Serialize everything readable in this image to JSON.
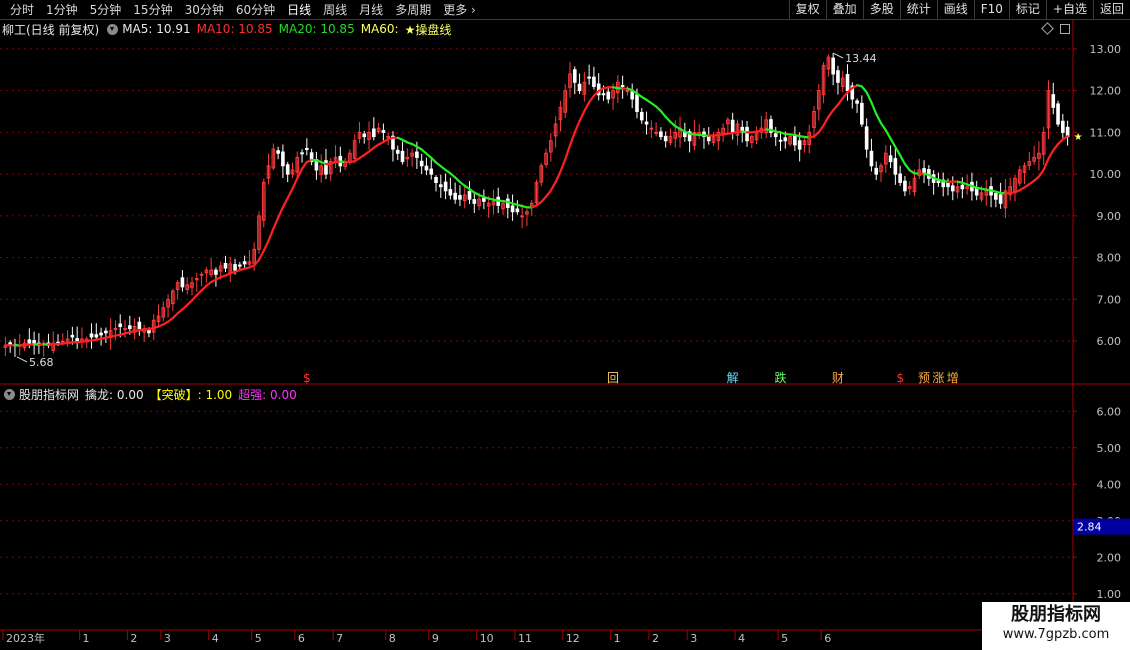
{
  "toolbar": {
    "tabs": [
      "分时",
      "1分钟",
      "5分钟",
      "15分钟",
      "30分钟",
      "60分钟",
      "日线",
      "周线",
      "月线",
      "多周期",
      "更多"
    ],
    "active_tab": "日线",
    "right_buttons": [
      "复权",
      "叠加",
      "多股",
      "统计",
      "画线",
      "F10",
      "标记",
      "+自选",
      "返回"
    ]
  },
  "main_legend": {
    "title": "柳工(日线 前复权)",
    "ma5": "MA5: 10.91",
    "ma10": "MA10: 10.85",
    "ma20": "MA20: 10.85",
    "ma60": "MA60:",
    "signal": "★操盘线"
  },
  "sub_legend": {
    "title": "股朋指标网",
    "qinlong": "擒龙: 0.00",
    "tupo": "【突破】: 1.00",
    "chaoqiang": "超强: 0.00"
  },
  "colors": {
    "up": "#ff3b3b",
    "down": "#ffffff",
    "ma_up": "#ff2020",
    "ma_down": "#22ee22",
    "grid": "#8b0000",
    "axis_text": "#c0c0c0",
    "ma10_color": "#ff3030",
    "ma20_color": "#22dd22",
    "ma60_color": "#ffff66",
    "signal_color": "#ffff66",
    "tupo_color": "#ffff00",
    "chaoqiang_color": "#ff33ff",
    "highlight_box": "#0000a0"
  },
  "watermark": {
    "name": "股朋指标网",
    "url": "www.7gpzb.com"
  },
  "chart_data": [
    {
      "type": "candlestick",
      "ylim": [
        5.5,
        13.5
      ],
      "y_ticks": [
        "13.00",
        "12.00",
        "11.00",
        "10.00",
        "9.00",
        "8.00",
        "7.00",
        "6.00"
      ],
      "y_tick_values": [
        13,
        12,
        11,
        10,
        9,
        8,
        7,
        6
      ],
      "x_labels": [
        "2023年",
        "1",
        "2",
        "3",
        "4",
        "5",
        "6",
        "7",
        "8",
        "9",
        "10",
        "11",
        "12",
        "1",
        "2",
        "3",
        "4",
        "5",
        "6"
      ],
      "x_label_index": [
        0,
        16,
        26,
        33,
        43,
        52,
        61,
        69,
        80,
        89,
        99,
        107,
        117,
        127,
        135,
        143,
        153,
        162,
        171
      ],
      "annotations": {
        "high": "13.44",
        "low": "5.68"
      },
      "closes": [
        5.9,
        5.9,
        5.9,
        5.9,
        5.95,
        5.95,
        5.95,
        5.9,
        5.95,
        5.9,
        5.95,
        5.95,
        6.0,
        6.05,
        6.1,
        6.0,
        6.05,
        6.05,
        6.1,
        6.1,
        6.15,
        6.2,
        6.25,
        6.3,
        6.35,
        6.3,
        6.3,
        6.35,
        6.3,
        6.3,
        6.2,
        6.5,
        6.6,
        6.8,
        7.0,
        7.2,
        7.4,
        7.3,
        7.35,
        7.4,
        7.5,
        7.6,
        7.7,
        7.7,
        7.6,
        7.8,
        7.75,
        7.85,
        7.7,
        7.8,
        7.85,
        7.9,
        8.2,
        9.0,
        9.8,
        10.2,
        10.6,
        10.5,
        10.2,
        10.0,
        10.1,
        10.4,
        10.5,
        10.6,
        10.3,
        10.1,
        10.2,
        10.0,
        10.3,
        10.4,
        10.2,
        10.3,
        10.5,
        10.8,
        11.0,
        10.9,
        11.0,
        10.9,
        11.1,
        11.0,
        10.9,
        10.6,
        10.5,
        10.3,
        10.4,
        10.5,
        10.4,
        10.2,
        10.1,
        10.0,
        9.8,
        9.7,
        9.6,
        9.5,
        9.4,
        9.4,
        9.5,
        9.4,
        9.3,
        9.4,
        9.35,
        9.3,
        9.35,
        9.25,
        9.3,
        9.2,
        9.1,
        9.1,
        9.0,
        9.1,
        9.3,
        9.8,
        10.2,
        10.5,
        10.8,
        11.2,
        11.6,
        12.0,
        12.4,
        12.2,
        12.0,
        12.2,
        12.3,
        12.1,
        11.9,
        11.9,
        11.8,
        12.0,
        12.2,
        12.1,
        12.0,
        11.8,
        11.5,
        11.3,
        11.2,
        11.1,
        11.0,
        10.9,
        10.8,
        10.9,
        11.0,
        11.1,
        10.9,
        10.8,
        11.0,
        11.0,
        10.9,
        10.8,
        10.9,
        11.0,
        11.1,
        11.3,
        11.0,
        11.2,
        11.0,
        10.8,
        10.9,
        11.0,
        11.1,
        11.3,
        11.0,
        10.9,
        10.8,
        10.8,
        10.9,
        10.7,
        10.6,
        10.8,
        11.0,
        11.5,
        12.0,
        12.6,
        12.8,
        12.4,
        12.2,
        12.3,
        12.0,
        11.8,
        11.7,
        11.2,
        10.6,
        10.2,
        10.0,
        10.2,
        10.5,
        10.3,
        10.0,
        9.8,
        9.6,
        9.7,
        9.9,
        10.1,
        10.0,
        9.9,
        9.8,
        9.8,
        9.7,
        9.7,
        9.6,
        9.7,
        9.65,
        9.7,
        9.6,
        9.5,
        9.55,
        9.6,
        9.5,
        9.4,
        9.3,
        9.6,
        9.7,
        9.9,
        10.1,
        10.2,
        10.3,
        10.4,
        10.5,
        11.0,
        12.0,
        11.6,
        11.2,
        11.0,
        10.9
      ]
    },
    {
      "type": "indicator",
      "ylim": [
        0.5,
        6.5
      ],
      "y_ticks": [
        "6.00",
        "5.00",
        "4.00",
        "3.00",
        "2.00",
        "1.00"
      ],
      "y_tick_values": [
        6,
        5,
        4,
        3,
        2,
        1
      ],
      "current_value": "2.84",
      "series": []
    }
  ],
  "signals": {
    "items": [
      "$",
      "回",
      "解",
      "跌",
      "财",
      "$",
      "预",
      "涨",
      "增"
    ],
    "index": [
      63,
      127,
      152,
      162,
      174,
      187,
      192,
      195,
      198
    ]
  }
}
